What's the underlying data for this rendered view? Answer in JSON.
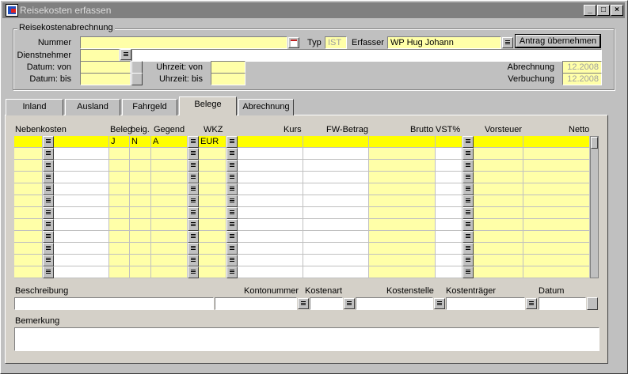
{
  "window": {
    "title": "Reisekosten erfassen"
  },
  "header": {
    "group_title": "Reisekostenabrechnung",
    "nummer_label": "Nummer",
    "typ_label": "Typ",
    "typ_value": "IST",
    "erfasser_label": "Erfasser",
    "erfasser_value": "WP Hug Johann",
    "antrag_button": "Antrag übernehmen",
    "dienstnehmer_label": "Dienstnehmer",
    "datum_von_label": "Datum: von",
    "datum_bis_label": "Datum: bis",
    "uhrzeit_von_label": "Uhrzeit: von",
    "uhrzeit_bis_label": "Uhrzeit: bis",
    "abrechnung_label": "Abrechnung",
    "abrechnung_value": "12.2008",
    "verbuchung_label": "Verbuchung",
    "verbuchung_value": "12.2008"
  },
  "tabs": [
    {
      "label": "Inland"
    },
    {
      "label": "Ausland"
    },
    {
      "label": "Fahrgeld"
    },
    {
      "label": "Belege"
    },
    {
      "label": "Abrechnung"
    }
  ],
  "active_tab": "Belege",
  "grid": {
    "headers": {
      "nebenkosten": "Nebenkosten",
      "beleg": "Beleg",
      "beig": "beig.",
      "gegend": "Gegend",
      "wkz": "WKZ",
      "kurs": "Kurs",
      "fw_betrag": "FW-Betrag",
      "brutto": "Brutto",
      "vst": "VST%",
      "vorsteuer": "Vorsteuer",
      "netto": "Netto"
    },
    "first_row": {
      "beleg": "J",
      "beig": "N",
      "gegend": "A",
      "wkz": "EUR"
    }
  },
  "footer": {
    "beschreibung_label": "Beschreibung",
    "kontonummer_label": "Kontonummer",
    "kostenart_label": "Kostenart",
    "kostenstelle_label": "Kostenstelle",
    "kostentraeger_label": "Kostenträger",
    "datum_label": "Datum",
    "bemerkung_label": "Bemerkung"
  },
  "colors": {
    "field_yellow": "#ffffa8",
    "selected_row": "#ffff00",
    "active_panel": "#d4d0c8"
  }
}
